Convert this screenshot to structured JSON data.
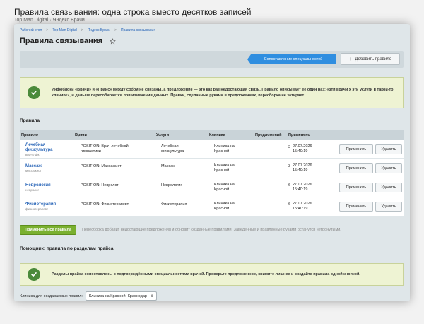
{
  "page": {
    "title": "Правила связывания: одна строка вместо десятков записей",
    "subtitle": "Top Man Digital · Яндекс.Врачи"
  },
  "breadcrumbs": [
    "Рабочий стол",
    "Top Man Digital",
    "Яндекс.Врачи",
    "Правила связывания"
  ],
  "breadcrumb_sep": ">",
  "header": {
    "title": "Правила связывания"
  },
  "toolbar": {
    "tab_active": "Сопоставление специальностей",
    "add_button": "Добавить правило"
  },
  "notice1": {
    "text": "Инфоблоки «Врачи» и «Прайс» между собой не связаны, а предложение — это как раз недостающая связь. Правило описывает её один раз: «эти врачи х эти услуги в такой-то клинике», и дальше пересобирается при изменении данных. Правки, сделанные руками в предложениях, пересборка не затирает."
  },
  "rules_section": {
    "title": "Правила"
  },
  "table": {
    "columns": [
      "Правило",
      "Врачи",
      "Услуги",
      "Клиника",
      "Предложений",
      "Применено"
    ],
    "rows": [
      {
        "name_1": "Лечебная",
        "name_2": "физкультура",
        "code": "врач-лфк",
        "doctors_1": "POSITION: Врач лечебной",
        "doctors_2": "гимнастики",
        "service_1": "Лечебная",
        "service_2": "физкультура",
        "clinic_1": "Клиника на",
        "clinic_2": "Красной",
        "offers": "3",
        "date": "27.07.2026",
        "time": "15:40:19"
      },
      {
        "name_1": "Массаж",
        "name_2": "",
        "code": "массажист",
        "doctors_1": "POSITION: Массажист",
        "doctors_2": "",
        "service_1": "Массаж",
        "service_2": "",
        "clinic_1": "Клиника на",
        "clinic_2": "Красной",
        "offers": "3",
        "date": "27.07.2026",
        "time": "15:40:19"
      },
      {
        "name_1": "Неврология",
        "name_2": "",
        "code": "невролог",
        "doctors_1": "POSITION: Невролог",
        "doctors_2": "",
        "service_1": "Неврология",
        "service_2": "",
        "clinic_1": "Клиника на",
        "clinic_2": "Красной",
        "offers": "6",
        "date": "27.07.2026",
        "time": "15:40:19"
      },
      {
        "name_1": "Физиотерапия",
        "name_2": "",
        "code": "физиотерапевт",
        "doctors_1": "POSITION: Физиотерапевт",
        "doctors_2": "",
        "service_1": "Физиотерапия",
        "service_2": "",
        "clinic_1": "Клиника на",
        "clinic_2": "Красной",
        "offers": "6",
        "date": "27.07.2026",
        "time": "15:40:19"
      }
    ],
    "apply_label": "Применить",
    "delete_label": "Удалить"
  },
  "apply_all": {
    "button": "Применить все правила",
    "hint": "Пересборка добавит недостающие предложения и обновит созданные правилами. Заведённые и правленные руками останутся нетронутыми."
  },
  "helper_section": {
    "title": "Помощник: правила по разделам прайса"
  },
  "notice2": {
    "text": "Разделы прайса сопоставлены с подтверждёнными специальностями врачей. Проверьте предложенное, снимите лишнее и создайте правила одной кнопкой."
  },
  "clinic_picker": {
    "label": "Клиника для создаваемых правил:",
    "value": "Клиника на Красной, Краснодар"
  },
  "colors": {
    "accent": "#2f8ee0",
    "success": "#4b8a3b",
    "primary_button": "#7ab02f",
    "link": "#2a66b8"
  }
}
